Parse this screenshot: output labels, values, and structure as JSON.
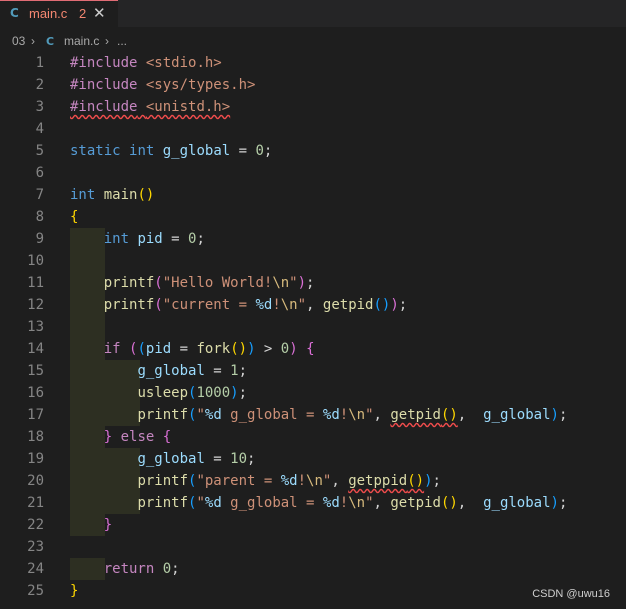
{
  "tab": {
    "lang_icon": "C",
    "filename": "main.c",
    "problems": "2",
    "close": "✕"
  },
  "breadcrumb": {
    "folder": "03",
    "sep1": "›",
    "lang_icon": "C",
    "file": "main.c",
    "sep2": "›",
    "more": "..."
  },
  "editor": {
    "line_numbers": [
      "1",
      "2",
      "3",
      "4",
      "5",
      "6",
      "7",
      "8",
      "9",
      "10",
      "11",
      "12",
      "13",
      "14",
      "15",
      "16",
      "17",
      "18",
      "19",
      "20",
      "21",
      "22",
      "23",
      "24",
      "25"
    ],
    "lines": [
      "#include <stdio.h>",
      "#include <sys/types.h>",
      "#include <unistd.h>",
      "",
      "static int g_global = 0;",
      "",
      "int main()",
      "{",
      "    int pid = 0;",
      "",
      "    printf(\"Hello World!\\n\");",
      "    printf(\"current = %d!\\n\", getpid());",
      "",
      "    if ((pid = fork()) > 0) {",
      "        g_global = 1;",
      "        usleep(1000);",
      "        printf(\"%d g_global = %d!\\n\", getpid(),  g_global);",
      "    } else {",
      "        g_global = 10;",
      "        printf(\"parent = %d!\\n\", getppid());",
      "        printf(\"%d g_global = %d!\\n\", getpid(),  g_global);",
      "    }",
      "",
      "    return 0;",
      "}"
    ]
  },
  "watermark": "CSDN @uwu16",
  "colors": {
    "background": "#1e1e1e",
    "keyword": "#569cd6",
    "control": "#c586c0",
    "function": "#dcdcaa",
    "variable": "#9cdcfe",
    "string": "#ce9178",
    "number": "#b5cea8",
    "error_squiggle": "#f14c4c"
  }
}
